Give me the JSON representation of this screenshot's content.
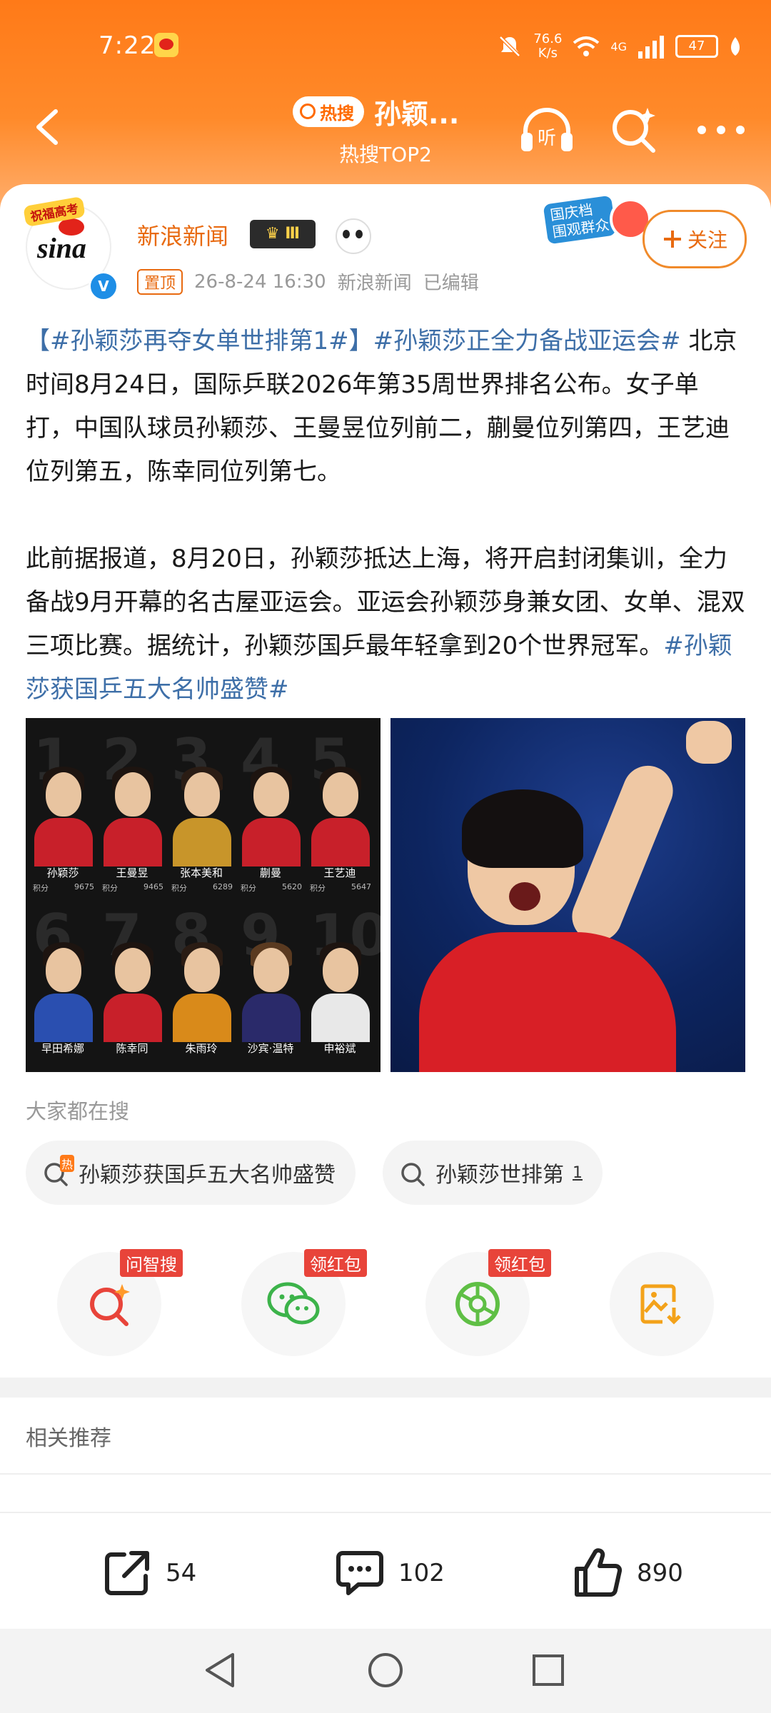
{
  "status_bar": {
    "time": "7:22",
    "net_speed_value": "76.6",
    "net_speed_unit": "K/s",
    "network": "4G",
    "battery": "47"
  },
  "header": {
    "hot_pill": "热搜",
    "title": "孙颖...",
    "subtitle": "热搜TOP2"
  },
  "post": {
    "avatar_ribbon": "祝福高考",
    "avatar_logo": "sina",
    "author": "新浪新闻",
    "vip_level": "Ⅲ",
    "pinned": "置顶",
    "date": "26-8-24 16:30",
    "source": "新浪新闻",
    "edited": "已编辑",
    "promo_text": "国庆档\n围观群众",
    "follow_label": "关注",
    "tag1": "【#孙颖莎再夺女单世排第1#】",
    "tag2": "#孙颖莎正全力备战亚运会#",
    "para1_rest": " 北京时间8月24日，国际乒联2026年第35周世界排名公布。女子单打，中国队球员孙颖莎、王曼昱位列前二，蒯曼位列第四，王艺迪位列第五，陈幸同位列第七。",
    "para2": "此前据报道，8月20日，孙颖莎抵达上海，将开启封闭集训，全力备战9月开幕的名古屋亚运会。亚运会孙颖莎身兼女团、女单、混双三项比赛。据统计，孙颖莎国乒最年轻拿到20个世界冠军。",
    "tag3": "#孙颖莎获国乒五大名帅盛赞#"
  },
  "ranking_image": {
    "players": [
      {
        "rank": "1",
        "name": "孙颖莎",
        "score": "9675"
      },
      {
        "rank": "2",
        "name": "王曼昱",
        "score": "9465"
      },
      {
        "rank": "3",
        "name": "张本美和",
        "score": "6289"
      },
      {
        "rank": "4",
        "name": "蒯曼",
        "score": "5620"
      },
      {
        "rank": "5",
        "name": "王艺迪",
        "score": "5647"
      },
      {
        "rank": "6",
        "name": "早田希娜",
        "score": ""
      },
      {
        "rank": "7",
        "name": "陈幸同",
        "score": ""
      },
      {
        "rank": "8",
        "name": "朱雨玲",
        "score": ""
      },
      {
        "rank": "9",
        "name": "沙宾·温特",
        "score": ""
      },
      {
        "rank": "10",
        "name": "申裕斌",
        "score": ""
      }
    ],
    "score_label": "积分"
  },
  "search": {
    "label": "大家都在搜",
    "chips": [
      {
        "text": "孙颖莎获国乒五大名帅盛赞",
        "hot": "热"
      },
      {
        "text": "孙颖莎世排第",
        "num": "1"
      }
    ]
  },
  "actions": [
    {
      "name": "问智搜",
      "badge": "问智搜"
    },
    {
      "name": "wechat",
      "badge": "领红包"
    },
    {
      "name": "moments",
      "badge": "领红包"
    },
    {
      "name": "save-image",
      "badge": ""
    }
  ],
  "related_label": "相关推荐",
  "bottom": {
    "share": "54",
    "comment": "102",
    "like": "890"
  },
  "colors": {
    "header_orange": "#ff7a18",
    "accent_orange": "#e86a10",
    "link_blue": "#3e6fa8",
    "red_badge": "#e8443a"
  }
}
